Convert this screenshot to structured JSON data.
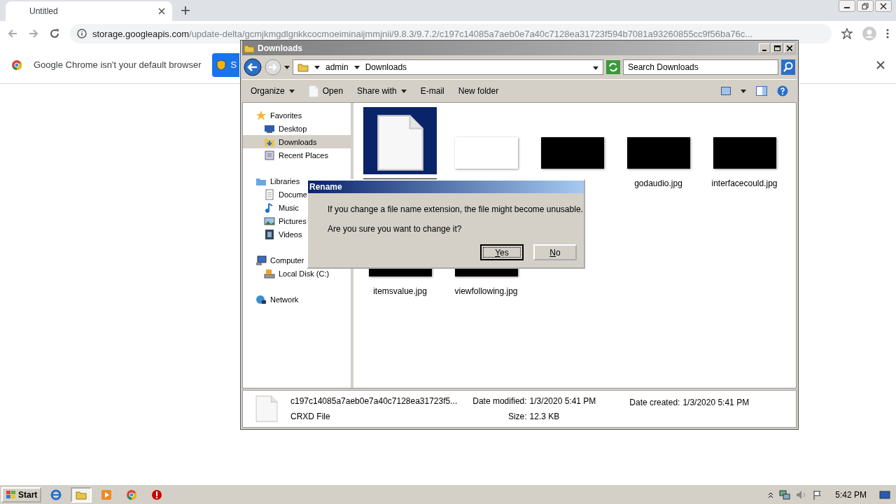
{
  "browser": {
    "tab": {
      "title": "Untitled",
      "selected": true
    },
    "url": {
      "host": "storage.googleapis.com",
      "path": "/update-delta/gcmjkmgdlgnkkcocmoeiminaijmmjnii/9.8.3/9.7.2/c197c14085a7aeb0e7a40c7128ea31723f594b7081a93260855cc9f56ba76c..."
    },
    "infobar": {
      "message": "Google Chrome isn't your default browser",
      "button": "S"
    }
  },
  "explorer": {
    "title": "Downloads",
    "breadcrumb": [
      "admin",
      "Downloads"
    ],
    "search": {
      "placeholder": "Search Downloads"
    },
    "toolbar": [
      {
        "label": "Organize",
        "kind": "menu"
      },
      {
        "label": "Open",
        "kind": "open"
      },
      {
        "label": "Share with",
        "kind": "menu"
      },
      {
        "label": "E-mail",
        "kind": "plain"
      },
      {
        "label": "New folder",
        "kind": "plain"
      }
    ],
    "sidebar": [
      {
        "label": "Favorites",
        "kind": "star",
        "children": [
          {
            "label": "Desktop",
            "kind": "desktop",
            "selected": false
          },
          {
            "label": "Downloads",
            "kind": "downloads",
            "selected": true
          },
          {
            "label": "Recent Places",
            "kind": "recent",
            "selected": false
          }
        ]
      },
      {
        "label": "Libraries",
        "kind": "library",
        "children": [
          {
            "label": "Docume",
            "kind": "docs",
            "selected": false
          },
          {
            "label": "Music",
            "kind": "music",
            "selected": false
          },
          {
            "label": "Pictures",
            "kind": "pictures",
            "selected": false
          },
          {
            "label": "Videos",
            "kind": "videos",
            "selected": false
          }
        ]
      },
      {
        "label": "Computer",
        "kind": "computer",
        "children": [
          {
            "label": "Local Disk (C:)",
            "kind": "disk",
            "selected": false
          }
        ]
      },
      {
        "label": "Network",
        "kind": "network"
      }
    ],
    "files": [
      {
        "kind": "document",
        "selected": true
      },
      {
        "kind": "light",
        "selected": false
      },
      {
        "kind": "dark",
        "selected": false
      },
      {
        "name": "godaudio.jpg",
        "kind": "dark",
        "selected": false
      },
      {
        "name": "interfacecould.jpg",
        "kind": "dark",
        "selected": false
      },
      {
        "name": "itemsvalue.jpg",
        "kind": "dark",
        "selected": false
      },
      {
        "name": "viewfollowing.jpg",
        "kind": "dark",
        "selected": false
      }
    ],
    "details": {
      "name": "c197c14085a7aeb0e7a40c7128ea31723f5...",
      "type": "CRXD File",
      "fields": [
        {
          "label": "Date modified:",
          "value": "1/3/2020 5:41 PM"
        },
        {
          "label": "Date created:",
          "value": "1/3/2020 5:41 PM"
        },
        {
          "label": "Size:",
          "value": "12.3 KB"
        }
      ]
    }
  },
  "dialog": {
    "title": "Rename",
    "message": "If you change a file name extension, the file might become unusable.",
    "question": "Are you sure you want to change it?",
    "buttons": [
      {
        "label": "Yes",
        "default": true
      },
      {
        "label": "No",
        "default": false
      }
    ]
  },
  "taskbar": {
    "start": "Start",
    "apps": [
      {
        "kind": "ie",
        "selected": false
      },
      {
        "kind": "explorer",
        "selected": true
      },
      {
        "kind": "media",
        "selected": false
      },
      {
        "kind": "chrome",
        "selected": false
      },
      {
        "kind": "stop",
        "selected": false
      }
    ],
    "time": "5:42 PM"
  }
}
